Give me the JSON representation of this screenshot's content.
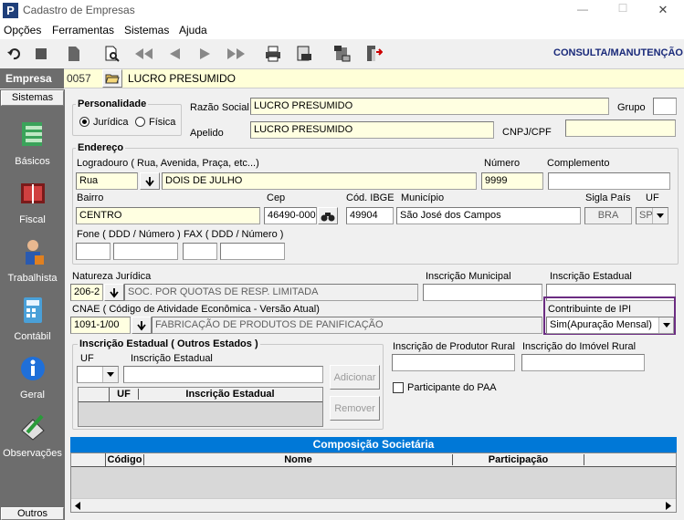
{
  "window": {
    "title": "Cadastro de Empresas",
    "minimize": "—",
    "maximize": "☐",
    "close": "✕"
  },
  "menu": [
    "Opções",
    "Ferramentas",
    "Sistemas",
    "Ajuda"
  ],
  "toolbar": {
    "mode": "CONSULTA/MANUTENÇÃO"
  },
  "empresa": {
    "label": "Empresa",
    "code": "0057",
    "name": "LUCRO PRESUMIDO"
  },
  "sidebar": {
    "header": "Sistemas",
    "items": [
      "Básicos",
      "Fiscal",
      "Trabalhista",
      "Contábil",
      "Geral",
      "Observações"
    ],
    "footer": "Outros"
  },
  "personalidade": {
    "title": "Personalidade",
    "juridica": "Jurídica",
    "fisica": "Física"
  },
  "razao": {
    "label": "Razão Social",
    "value": "LUCRO PRESUMIDO"
  },
  "grupo": {
    "label": "Grupo",
    "value": ""
  },
  "apelido": {
    "label": "Apelido",
    "value": "LUCRO PRESUMIDO"
  },
  "cnpj": {
    "label": "CNPJ/CPF",
    "value": ""
  },
  "endereco": {
    "title": "Endereço",
    "logradouro_label": "Logradouro ( Rua, Avenida, Praça, etc...)",
    "tipo": "Rua",
    "logradouro": "DOIS DE JULHO",
    "numero_label": "Número",
    "numero": "9999",
    "complemento_label": "Complemento",
    "complemento": "",
    "bairro_label": "Bairro",
    "bairro": "CENTRO",
    "cep_label": "Cep",
    "cep": "46490-000",
    "ibge_label": "Cód. IBGE",
    "ibge": "49904",
    "municipio_label": "Município",
    "municipio": "São José dos Campos",
    "pais_label": "Sigla País",
    "pais": "BRA",
    "uf_label": "UF",
    "uf": "SP",
    "fone_label": "Fone ( DDD / Número )",
    "fax_label": "FAX ( DDD / Número )"
  },
  "natureza": {
    "label": "Natureza Jurídica",
    "code": "206-2",
    "desc": "SOC. POR QUOTAS DE RESP. LIMITADA"
  },
  "insc_municipal": {
    "label": "Inscrição Municipal",
    "value": ""
  },
  "insc_estadual": {
    "label": "Inscrição Estadual",
    "value": ""
  },
  "cnae": {
    "label": "CNAE ( Código de Atividade Econômica - Versão Atual)",
    "code": "1091-1/00",
    "desc": "FABRICAÇÃO DE PRODUTOS DE PANIFICAÇÃO"
  },
  "ipi": {
    "label": "Contribuinte de IPI",
    "value": "Sim(Apuração Mensal)"
  },
  "ie_outros": {
    "title": "Inscrição Estadual ( Outros Estados )",
    "uf_label": "UF",
    "ie_label": "Inscrição Estadual",
    "add": "Adicionar",
    "remove": "Remover",
    "col_uf": "UF",
    "col_ie": "Inscrição Estadual"
  },
  "produtor": {
    "label": "Inscrição de Produtor Rural",
    "value": ""
  },
  "imovel": {
    "label": "Inscrição do Imóvel Rural",
    "value": ""
  },
  "paa": {
    "label": "Participante do PAA"
  },
  "socios": {
    "title": "Composição Societária",
    "col_codigo": "Código",
    "col_nome": "Nome",
    "col_part": "Participação"
  },
  "colors": {
    "accent": "#0078d7",
    "highlight": "#6b2c82",
    "sidebar": "#6d6d6d",
    "empresa_bar": "#ffffd8"
  }
}
